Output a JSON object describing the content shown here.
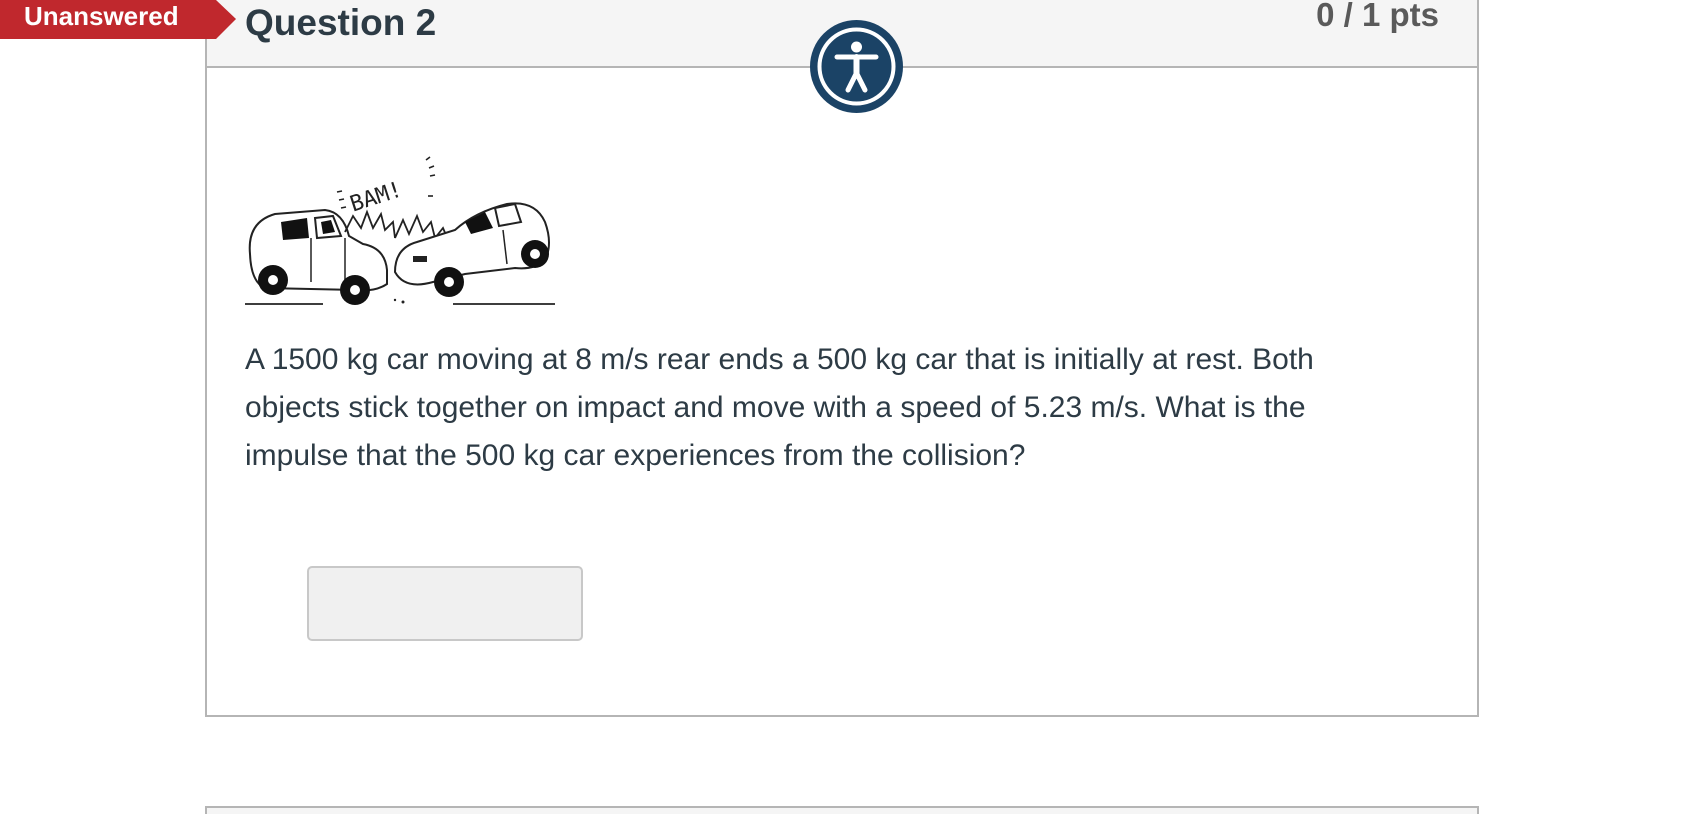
{
  "status_flag": {
    "label": "Unanswered",
    "color": "#c0282d"
  },
  "question": {
    "title": "Question 2",
    "points": "0 / 1 pts",
    "image_icon": "car-collision-illustration",
    "illustration_caption": "BAM!",
    "text": "A 1500 kg car moving at 8 m/s rear ends a 500 kg car that is initially at rest. Both objects stick together on impact and move with a speed of 5.23 m/s. What is the impulse that the 500 kg car experiences from the collision?",
    "answer_value": "",
    "answer_placeholder": ""
  },
  "accessibility": {
    "icon": "accessibility-icon",
    "color": "#1b4366"
  }
}
